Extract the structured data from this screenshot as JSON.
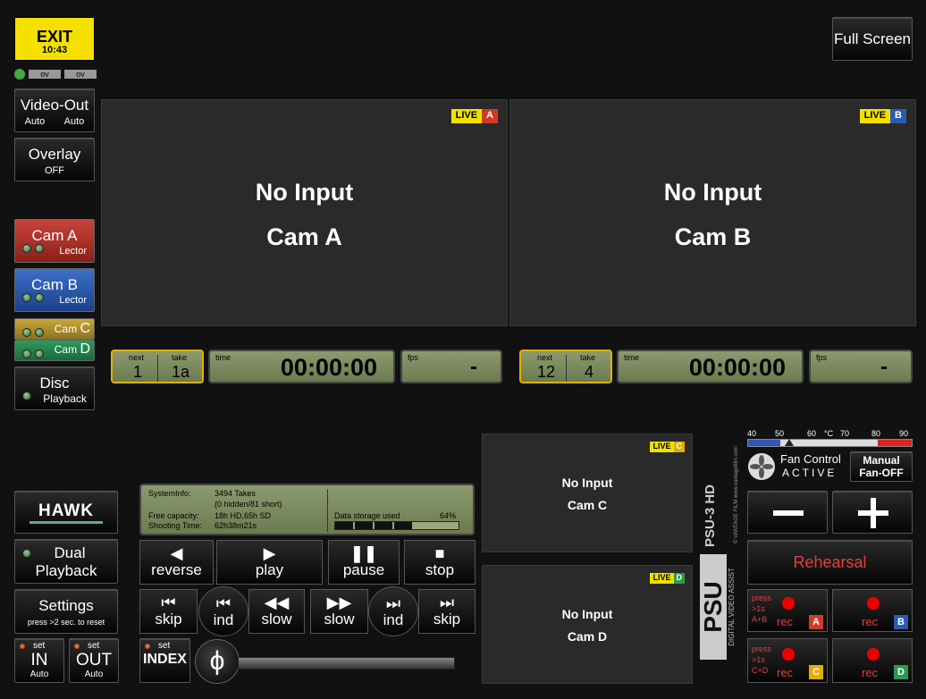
{
  "exit": {
    "label": "EXIT",
    "time": "10:43"
  },
  "ov": [
    "ov",
    "ov"
  ],
  "fullscreen": "Full Screen",
  "video_out": {
    "title": "Video-Out",
    "left": "Auto",
    "right": "Auto"
  },
  "overlay": {
    "title": "Overlay",
    "state": "OFF"
  },
  "cams": {
    "a": {
      "title": "Cam A",
      "sub": "Lector"
    },
    "b": {
      "title": "Cam B",
      "sub": "Lector"
    },
    "c": {
      "title": "Cam",
      "letter": "C"
    },
    "d": {
      "title": "Cam",
      "letter": "D"
    }
  },
  "disc": {
    "title": "Disc",
    "sub": "Playback"
  },
  "views": {
    "a": {
      "line1": "No Input",
      "line2": "Cam A",
      "live": "LIVE",
      "cam": "A"
    },
    "b": {
      "line1": "No Input",
      "line2": "Cam B",
      "live": "LIVE",
      "cam": "B"
    },
    "c": {
      "line1": "No Input",
      "line2": "Cam C",
      "live": "LIVE",
      "cam": "C"
    },
    "d": {
      "line1": "No Input",
      "line2": "Cam D",
      "live": "LIVE",
      "cam": "D"
    }
  },
  "counters": {
    "a": {
      "next_lbl": "next",
      "take_lbl": "take",
      "next": "1",
      "take": "1a",
      "time_lbl": "time",
      "time": "00:00:00",
      "fps_lbl": "fps",
      "fps": "-"
    },
    "b": {
      "next_lbl": "next",
      "take_lbl": "take",
      "next": "12",
      "take": "4",
      "time_lbl": "time",
      "time": "00:00:00",
      "fps_lbl": "fps",
      "fps": "-"
    }
  },
  "sysinfo": {
    "label1": "SystemInfo:",
    "val1": "3494 Takes",
    "val1b": "(0 hidden/81 short)",
    "label2": "Free capacity:",
    "val2": "18h HD,65h SD",
    "label3": "Shooting Time:",
    "val3": "62h38m21s",
    "storage_label": "Data storage used",
    "storage_pct": "64%",
    "storage_value": 64
  },
  "hawk": "HAWK",
  "dual": {
    "line1": "Dual",
    "line2": "Playback"
  },
  "settings": {
    "title": "Settings",
    "sub": "press >2 sec. to reset"
  },
  "set_in": {
    "set": "set",
    "big": "IN",
    "sub": "Auto"
  },
  "set_out": {
    "set": "set",
    "big": "OUT",
    "sub": "Auto"
  },
  "set_index": {
    "set": "set",
    "big": "INDEX"
  },
  "transport": {
    "reverse": "reverse",
    "play": "play",
    "pause": "pause",
    "stop": "stop",
    "skip": "skip",
    "ind": "ind",
    "slow": "slow"
  },
  "jog": "ϕ",
  "temp": {
    "ticks": [
      "40",
      "50",
      "60",
      "°C",
      "70",
      "80",
      "90"
    ]
  },
  "fan": {
    "title": "Fan Control",
    "state": "ACTIVE",
    "manual1": "Manual",
    "manual2": "Fan-OFF"
  },
  "rehearsal": "Rehearsal",
  "rec": {
    "press1": "press",
    "press2": ">1s",
    "combo_ab": "A+B",
    "combo_cd": "C+D",
    "label": "rec",
    "a": "A",
    "b": "B",
    "c": "C",
    "d": "D"
  },
  "brand": {
    "psu3": "PSU-3 HD",
    "web": "© VANTAGE FILM  www.vantagefilm.com",
    "psu": "PSU",
    "dva": "DIGITAL VIDEO ASSIST"
  },
  "colors": {
    "cam_a": "#b8302a",
    "cam_b": "#2a5cb0",
    "cam_c": "#c2a030",
    "cam_d": "#2a8a50",
    "live": "#f0e000"
  }
}
